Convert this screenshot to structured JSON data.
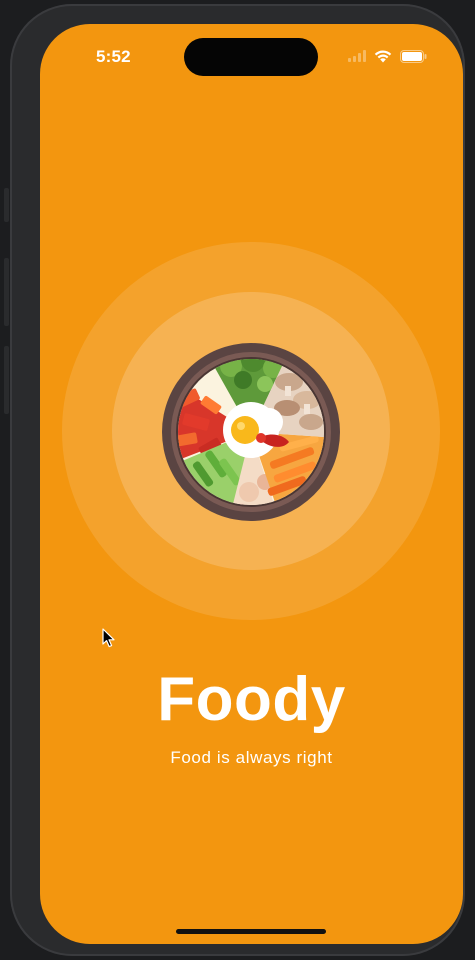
{
  "status_bar": {
    "time": "5:52",
    "icons": [
      "signal-icon",
      "wifi-icon",
      "battery-icon"
    ]
  },
  "splash": {
    "hero_image": "bibimbap-bowl-illustration",
    "title": "Foody",
    "tagline": "Food is always right"
  },
  "colors": {
    "background": "#f3960f",
    "text": "#ffffff"
  }
}
